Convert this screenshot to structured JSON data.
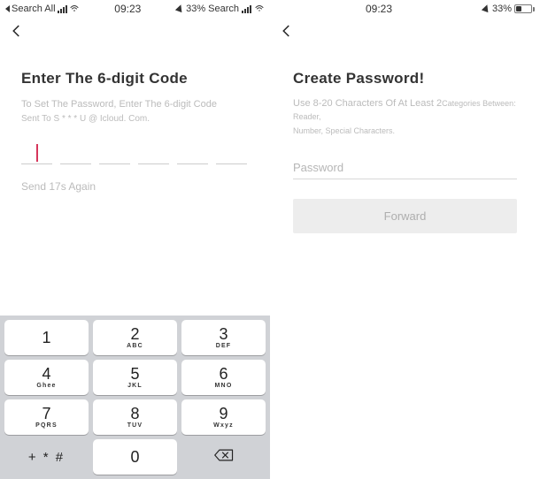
{
  "statusbar": {
    "left": {
      "appLabel": "Search All",
      "searchLabel": "Search"
    },
    "time": "09:23",
    "batteryPercent": "33%",
    "batteryFillWidth": "33%"
  },
  "left": {
    "title": "Enter The 6-digit Code",
    "subtitle_line1": "To Set The Password, Enter The 6-digit Code",
    "subtitle_line2": "Sent To S * * * U @ Icloud. Com.",
    "resend": "Send 17s Again"
  },
  "right": {
    "title": "Create Password!",
    "subtitle_a": "Use 8-20 Characters Of At Least 2",
    "subtitle_b": "Categories Between: Reader,",
    "subtitle_c": "Number, Special Characters.",
    "password_placeholder": "Password",
    "forward": "Forward"
  },
  "keypad": {
    "k1": {
      "num": "1",
      "sub": ""
    },
    "k2": {
      "num": "2",
      "sub": "ABC"
    },
    "k3": {
      "num": "3",
      "sub": "DEF"
    },
    "k4": {
      "num": "4",
      "sub": "Ghee"
    },
    "k5": {
      "num": "5",
      "sub": "JKL"
    },
    "k6": {
      "num": "6",
      "sub": "MNO"
    },
    "k7": {
      "num": "7",
      "sub": "PQRS"
    },
    "k8": {
      "num": "8",
      "sub": "TUV"
    },
    "k9": {
      "num": "9",
      "sub": "Wxyz"
    },
    "ksym": "+ * #",
    "k0": {
      "num": "0",
      "sub": ""
    }
  }
}
